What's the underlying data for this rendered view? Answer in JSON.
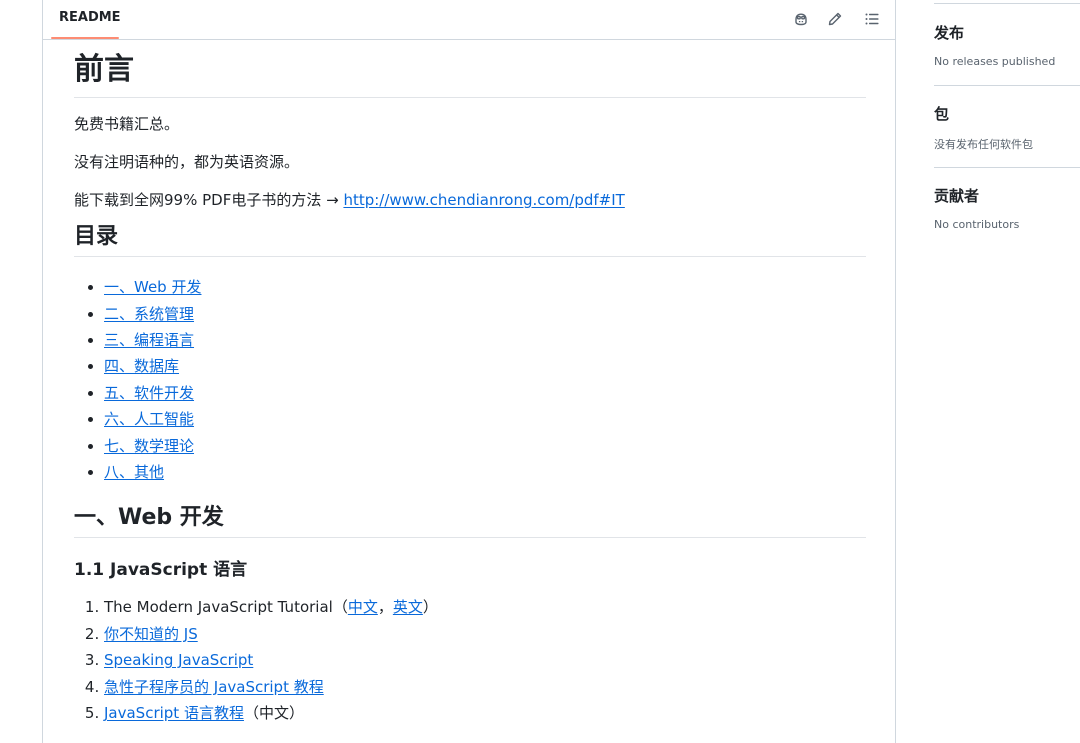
{
  "readme": {
    "tab_label": "README",
    "header_icons": [
      "copilot-icon",
      "pencil-icon",
      "list-unordered-icon"
    ],
    "title": "前言",
    "para1": "免费书籍汇总。",
    "para2": "没有注明语种的，都为英语资源。",
    "para3_text": "能下载到全网99% PDF电子书的方法 → ",
    "para3_link": "http://www.chendianrong.com/pdf#IT",
    "toc_heading": "目录",
    "toc": [
      "一、Web 开发",
      "二、系统管理",
      "三、编程语言",
      "四、数据库",
      "五、软件开发",
      "六、人工智能",
      "七、数学理论",
      "八、其他"
    ],
    "section1_heading": "一、Web 开发",
    "subsection_heading": "1.1 JavaScript 语言",
    "books": {
      "item1_text": "The Modern JavaScript Tutorial（",
      "item1_link1": "中文",
      "item1_sep": "，",
      "item1_link2": "英文",
      "item1_end": "）",
      "item2_link": "你不知道的 JS",
      "item3_link": "Speaking JavaScript",
      "item4_link": "急性子程序员的 JavaScript 教程",
      "item5_link": "JavaScript 语言教程",
      "item5_suffix": "（中文）"
    }
  },
  "sidebar": {
    "releases_title": "发布",
    "releases_text": "No releases published",
    "packages_title": "包",
    "packages_text": "没有发布任何软件包",
    "contributors_title": "贡献者",
    "contributors_text": "No contributors"
  },
  "colors": {
    "link": "#0969da",
    "tab_underline": "#fd8c73",
    "border": "#d0d7de"
  }
}
